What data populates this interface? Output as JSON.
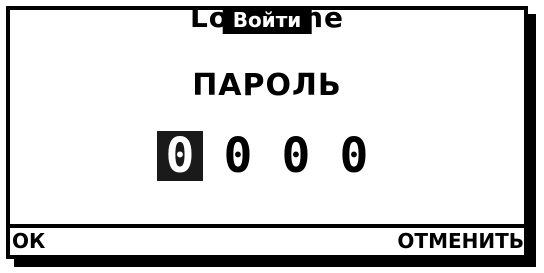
{
  "title": "Войти",
  "title_ghost": "Log in ne",
  "heading": "ПАРОЛЬ",
  "digits": [
    "0",
    "0",
    "0",
    "0"
  ],
  "active_digit_index": 0,
  "softkeys": {
    "left": "ОК",
    "right": "ОТМЕНИТЬ"
  },
  "colors": {
    "foreground": "#000000",
    "background": "#ffffff",
    "highlight": "#1a1a1a"
  }
}
